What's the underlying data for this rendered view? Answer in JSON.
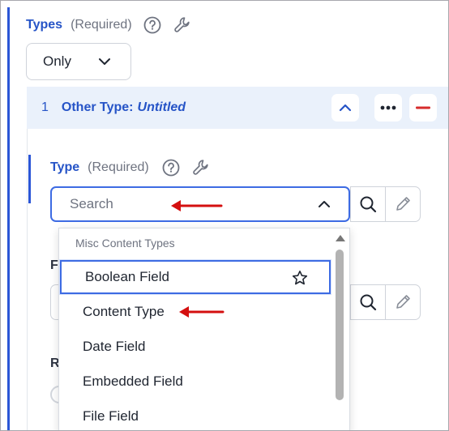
{
  "types_field": {
    "label": "Types",
    "required": "(Required)",
    "help_icon": "help-circle-icon",
    "settings_icon": "wrench-icon",
    "selected": "Only"
  },
  "card": {
    "index": "1",
    "title": "Other Type:",
    "title_value": "Untitled",
    "buttons": [
      "chevron-up-icon",
      "more-options-icon",
      "remove-icon"
    ]
  },
  "type_field": {
    "label": "Type",
    "required": "(Required)",
    "search_placeholder": "Search"
  },
  "background_letters": {
    "row2": "F",
    "row3": "R"
  },
  "dropdown": {
    "group_label": "Misc Content Types",
    "items": [
      {
        "label": "Boolean Field",
        "favorite": true
      },
      {
        "label": "Content Type",
        "favorite": false
      },
      {
        "label": "Date Field",
        "favorite": false
      },
      {
        "label": "Embedded Field",
        "favorite": false
      },
      {
        "label": "File Field",
        "favorite": false
      }
    ]
  },
  "colors": {
    "accent": "#2654c7",
    "rail": "#2b56d6",
    "header_bg": "#eaf1fb",
    "annotation_arrow": "#d40f0f",
    "remove": "#d62b2b"
  }
}
